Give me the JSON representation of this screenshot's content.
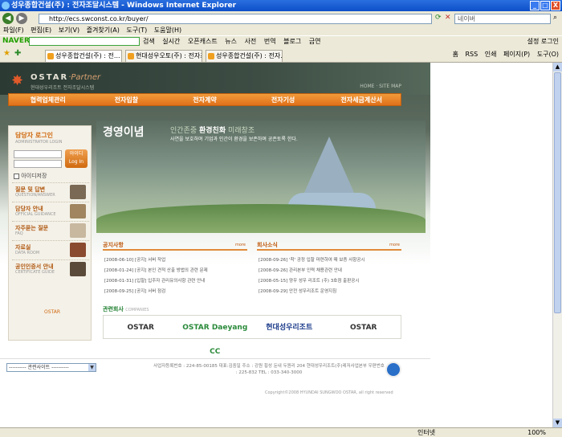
{
  "window": {
    "title": "성우종합건설(주) : 전자조달시스템 - Windows Internet Explorer",
    "controls": [
      "_",
      "□",
      "X"
    ]
  },
  "address": {
    "url": "http://ecs.swconst.co.kr/buyer/",
    "search_placeholder": "네이버"
  },
  "menu": [
    "파일(F)",
    "편집(E)",
    "보기(V)",
    "즐겨찾기(A)",
    "도구(T)",
    "도움말(H)"
  ],
  "naver": {
    "logo": "NAVER",
    "search_label": "검색",
    "items": [
      "실시간",
      "오픈캐스트",
      "뉴스",
      "사전",
      "번역",
      "블로그",
      "금연"
    ],
    "right": [
      "설정",
      "로그인"
    ]
  },
  "tabs": [
    {
      "label": "성우종합건설(주) : 전..."
    },
    {
      "label": "현대성우오토(주) : 전자조..."
    },
    {
      "label": "성우종합건설(주) : 전자..."
    }
  ],
  "tab_tools": [
    "홈",
    "RSS",
    "인쇄",
    "페이지(P)",
    "도구(O)"
  ],
  "site": {
    "logo": {
      "brand": "OSTAR",
      "partner": "·Partner",
      "sub": "현대성우리조트 전자조달시스템"
    },
    "header_links": "HOME · SITE MAP",
    "gnb": [
      "협력업체관리",
      "전자입찰",
      "전자계약",
      "전자기성",
      "전자세금계산서"
    ],
    "login": {
      "title": "담당자 로그인",
      "sub": "ADMINISTRATOR LOGIN",
      "button": "아이디 Log In",
      "save_id": "아이디저장"
    },
    "side_menu": [
      {
        "kr": "질문 및 답변",
        "en": "QUESTION/ANSWER"
      },
      {
        "kr": "담당자 안내",
        "en": "OFFICIAL GUIDANCE"
      },
      {
        "kr": "자주묻는 질문",
        "en": "FAQ"
      },
      {
        "kr": "자료실",
        "en": "DATA ROOM"
      },
      {
        "kr": "공인인증서 안내",
        "en": "CERTIFICATE GUIDE"
      }
    ],
    "side_logo": "OSTAR",
    "hero": {
      "title": "경영이념",
      "tag1": "인간존중",
      "tag2": "환경친화",
      "tag3": "미래창조",
      "desc": "사연을 보호하며 기업과 인간이 환경을 보존하며 공존토록 한다."
    },
    "notice": {
      "title": "공지사항",
      "more": "more",
      "items": [
        "[2008-06-10] [공지] 서버 작업",
        "[2008-01-24] [공지] 본인 견적 산출 방법의 관련 문제",
        "[2008-01-31] [입찰] 입주자 관리유의사항 관련 안내",
        "[2008-09-25] [공지] 서버 점검"
      ]
    },
    "news": {
      "title": "회사소식",
      "more": "more",
      "items": [
        "[2008-09-26] '착' 공정 입찰 마련하여 때 보증 사항공시",
        "[2008-09-26] 관리본부 인력 채용관련 안내",
        "[2008-05-15] 양우 성우 리조트 (주) 3호점 출판공시",
        "[2008-09-29] 안전 성우리조트 운영지침"
      ]
    },
    "partners_title": "관련회사",
    "partners_sub": "COMPANIES",
    "partners": [
      "OSTAR",
      "OSTAR Daeyang CC",
      "현대성우리조트",
      "OSTAR"
    ],
    "family_select": "---------- 관련사이트 ----------",
    "footer_info": "사업자등록번호 : 224-85-00185  대표:김중일  주소 : 강원 횡성 둔내 두원리 204 현대성우리조트(주)레저사업본부  우편번호 : 225-832  TEL : 033-340-3000",
    "copyright": "Copyright©2008 HYUNDAI SUNGWOO OSTAR, all right reserved"
  },
  "status": {
    "zone": "인터넷",
    "zoom": "100%"
  }
}
